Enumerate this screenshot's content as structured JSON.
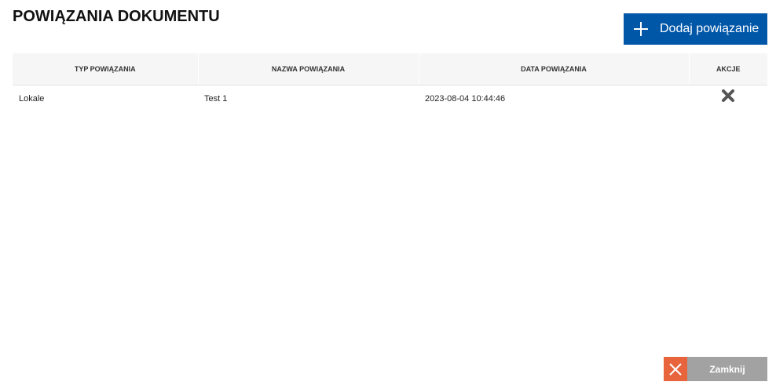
{
  "dialog": {
    "title": "POWIĄZANIA DOKUMENTU",
    "add_button_label": "Dodaj powiązanie",
    "close_button_label": "Zamknij"
  },
  "table": {
    "columns": [
      "TYP POWIĄZANIA",
      "NAZWA POWIĄZANIA",
      "DATA POWIĄZANIA",
      "AKCJE"
    ],
    "rows": [
      {
        "type": "Lokale",
        "name": "Test 1",
        "date": "2023-08-04 10:44:46",
        "action_icon": "delete-icon"
      }
    ]
  },
  "colors": {
    "primary": "#0057a8",
    "header_bg": "#f6f6f6",
    "close_accent": "#e8643c",
    "close_bg": "#a2a2a2",
    "delete_icon": "#555555"
  },
  "icons": {
    "add": "plus-icon",
    "delete": "delete-icon",
    "close": "close-icon"
  }
}
